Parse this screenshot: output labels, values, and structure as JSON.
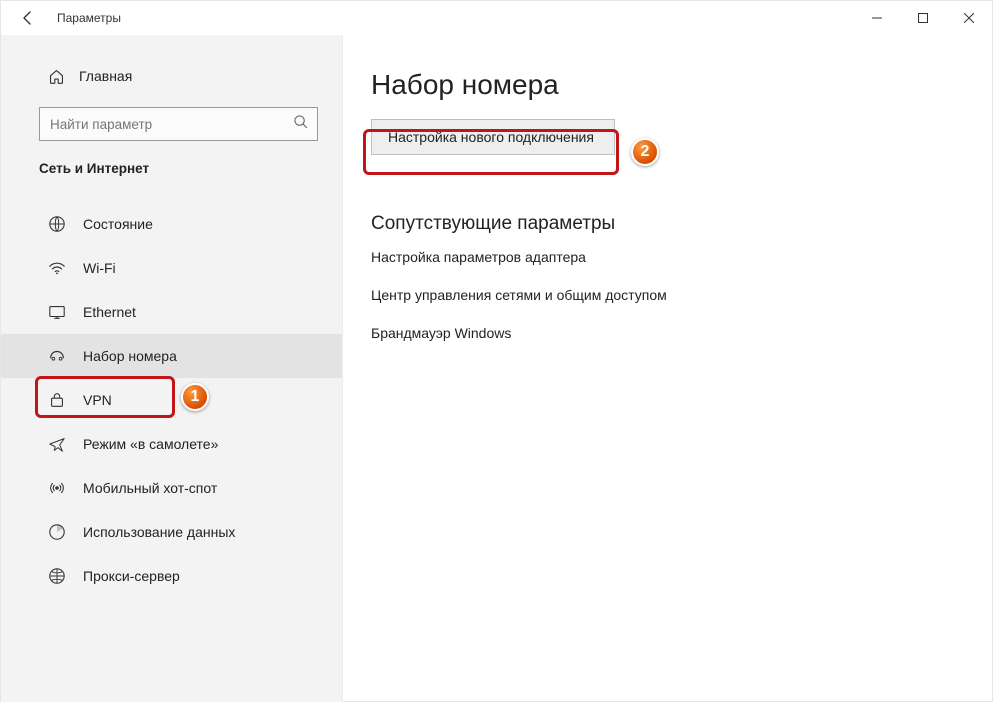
{
  "window": {
    "title": "Параметры"
  },
  "sidebar": {
    "home": "Главная",
    "search_placeholder": "Найти параметр",
    "section": "Сеть и Интернет",
    "items": [
      {
        "key": "status",
        "label": "Состояние"
      },
      {
        "key": "wifi",
        "label": "Wi-Fi"
      },
      {
        "key": "ethernet",
        "label": "Ethernet"
      },
      {
        "key": "dialup",
        "label": "Набор номера"
      },
      {
        "key": "vpn",
        "label": "VPN"
      },
      {
        "key": "airplane",
        "label": "Режим «в самолете»"
      },
      {
        "key": "hotspot",
        "label": "Мобильный хот-спот"
      },
      {
        "key": "datausage",
        "label": "Использование данных"
      },
      {
        "key": "proxy",
        "label": "Прокси-сервер"
      }
    ],
    "selected": "dialup"
  },
  "main": {
    "title": "Набор номера",
    "new_connection": "Настройка нового подключения",
    "related_title": "Сопутствующие параметры",
    "related_links": [
      "Настройка параметров адаптера",
      "Центр управления сетями и общим доступом",
      "Брандмауэр Windows"
    ]
  },
  "annotations": {
    "badge1": "1",
    "badge2": "2"
  }
}
